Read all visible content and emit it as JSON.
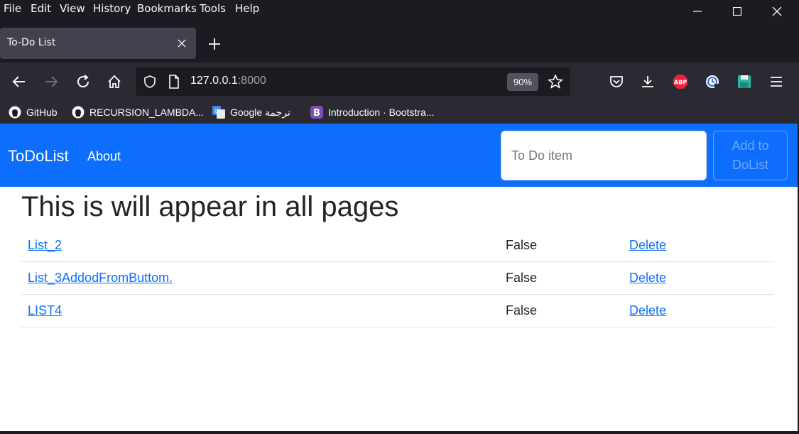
{
  "menu": [
    "File",
    "Edit",
    "View",
    "History",
    "Bookmarks",
    "Tools",
    "Help"
  ],
  "tab": {
    "title": "To-Do List"
  },
  "url": {
    "host": "127.0.0.1",
    "port": ":8000",
    "zoom": "90%"
  },
  "bookmarks": [
    {
      "label": "GitHub",
      "icon": "github-icon"
    },
    {
      "label": "RECURSION_LAMBDA...",
      "icon": "github-icon"
    },
    {
      "label": "Google ترجمة",
      "icon": "google-translate-icon"
    },
    {
      "label": "Introduction · Bootstra...",
      "icon": "bootstrap-icon"
    }
  ],
  "site": {
    "brand": "ToDoList",
    "about": "About",
    "input_placeholder": "To Do item",
    "add_button": "Add to\nDoList",
    "heading": "This is will appear in all pages",
    "delete_label": "Delete",
    "items": [
      {
        "name": "List_2",
        "status": "False"
      },
      {
        "name": "List_3AddodFromButtom.",
        "status": "False"
      },
      {
        "name": "LIST4",
        "status": "False"
      }
    ]
  },
  "colors": {
    "primary": "#0d6efd",
    "chrome_dark": "#1c1b22",
    "toolbar": "#2b2a33"
  }
}
